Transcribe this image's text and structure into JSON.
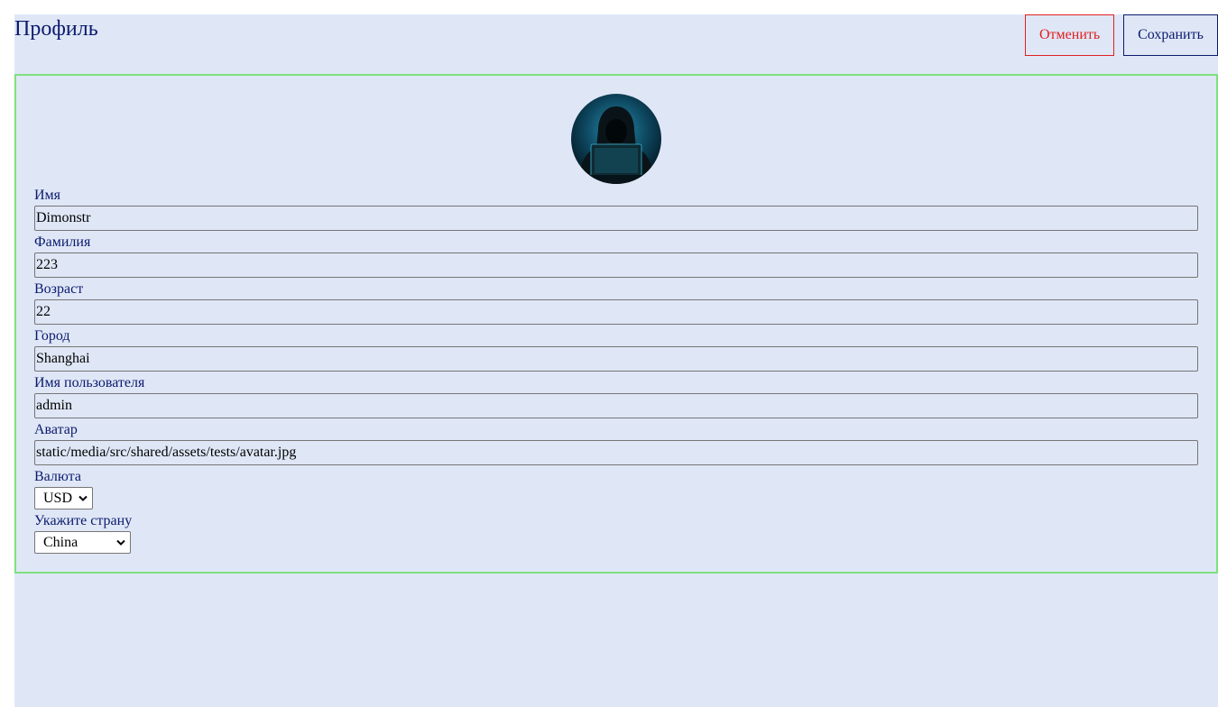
{
  "header": {
    "title": "Профиль",
    "cancel_label": "Отменить",
    "save_label": "Сохранить"
  },
  "avatar": {
    "icon": "hacker-avatar-image"
  },
  "form": {
    "first_name": {
      "label": "Имя",
      "value": "Dimonstr"
    },
    "last_name": {
      "label": "Фамилия",
      "value": "223"
    },
    "age": {
      "label": "Возраст",
      "value": "22"
    },
    "city": {
      "label": "Город",
      "value": "Shanghai"
    },
    "username": {
      "label": "Имя пользователя",
      "value": "admin"
    },
    "avatar_url": {
      "label": "Аватар",
      "value": "static/media/src/shared/assets/tests/avatar.jpg"
    },
    "currency": {
      "label": "Валюта",
      "value": "USD"
    },
    "country": {
      "label": "Укажите страну",
      "value": "China"
    }
  },
  "colors": {
    "background": "#dfe7f6",
    "primary": "#0b1a6e",
    "cancel": "#e02020",
    "card_border": "#7ee07e"
  }
}
